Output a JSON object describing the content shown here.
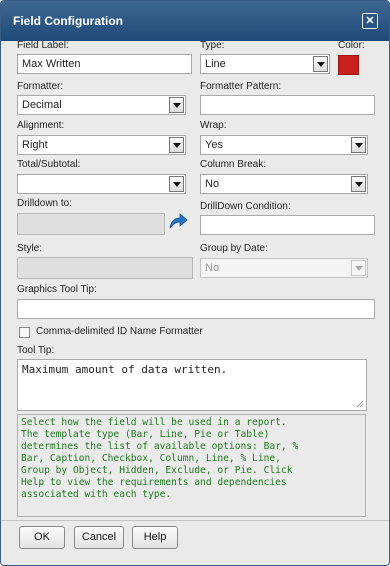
{
  "dialog": {
    "title": "Field Configuration",
    "close_glyph": "✕"
  },
  "field_label": {
    "label": "Field Label:",
    "value": "Max Written"
  },
  "type": {
    "label": "Type:",
    "value": "Line"
  },
  "color": {
    "label": "Color:",
    "value": "#c8211d"
  },
  "formatter": {
    "label": "Formatter:",
    "value": "Decimal"
  },
  "formatter_pattern": {
    "label": "Formatter Pattern:",
    "value": ""
  },
  "alignment": {
    "label": "Alignment:",
    "value": "Right"
  },
  "wrap": {
    "label": "Wrap:",
    "value": "Yes"
  },
  "total_subtotal": {
    "label": "Total/Subtotal:",
    "value": ""
  },
  "column_break": {
    "label": "Column Break:",
    "value": "No"
  },
  "drilldown_to": {
    "label": "Drilldown to:",
    "value": "",
    "icon": "drilldown-arrow-icon"
  },
  "drilldown_condition": {
    "label": "DrillDown Condition:",
    "value": ""
  },
  "style": {
    "label": "Style:",
    "value": ""
  },
  "group_by_date": {
    "label": "Group by Date:",
    "value": "No"
  },
  "graphics_tool_tip": {
    "label": "Graphics Tool Tip:",
    "value": ""
  },
  "comma_delimited": {
    "label": "Comma-delimited ID Name Formatter",
    "checked": false
  },
  "tool_tip": {
    "label": "Tool Tip:",
    "value": "Maximum amount of data written."
  },
  "help_text": [
    "Select how the field will be used in a report.",
    "The template type (Bar, Line, Pie or Table)",
    "determines the list of available options: Bar, %",
    "Bar, Caption, Checkbox, Column, Line, % Line,",
    "Group by Object, Hidden, Exclude, or Pie. Click",
    "Help to view the requirements and dependencies",
    "associated with each type."
  ],
  "buttons": {
    "ok": "OK",
    "cancel": "Cancel",
    "help": "Help"
  }
}
